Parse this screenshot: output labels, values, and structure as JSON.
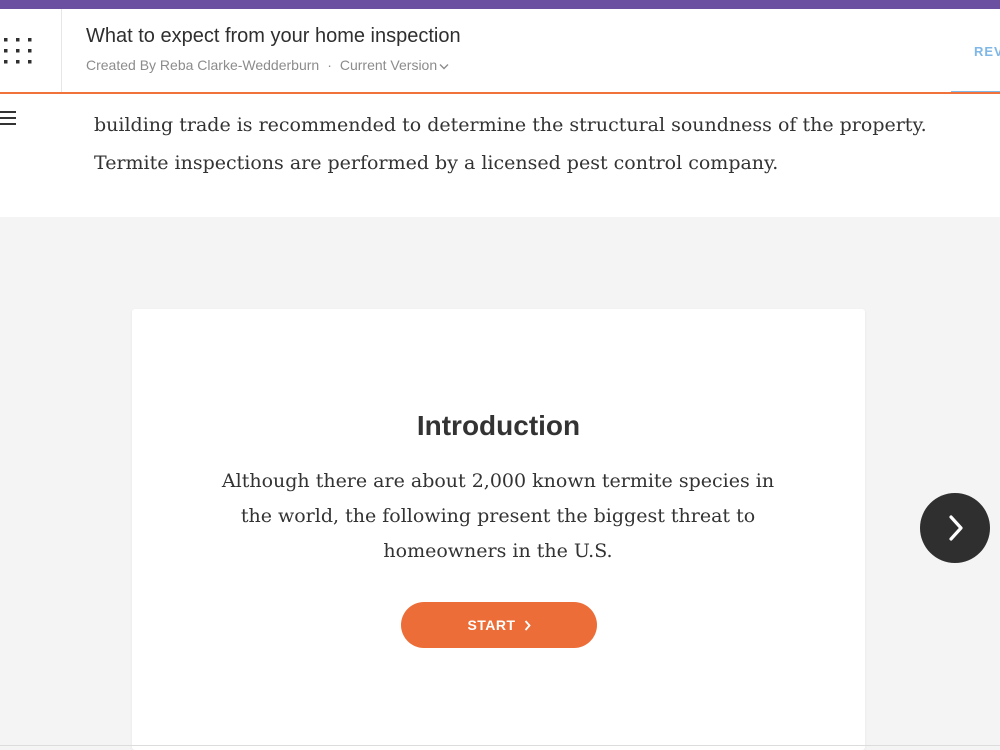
{
  "header": {
    "title": "What to expect from your home inspection",
    "created_by": "Created By Reba Clarke-Wedderburn",
    "separator": "·",
    "version_label": "Current Version",
    "review_tab": "REV",
    "icons": {
      "apps": "grid-dots-icon",
      "version_dropdown": "chevron-down-icon"
    }
  },
  "content": {
    "paragraph": "building trade is recommended to determine the structural soundness of the property. Termite inspections are performed by a licensed pest control company."
  },
  "intro_card": {
    "heading": "Introduction",
    "text": "Although there are about 2,000 known termite species in the world, the following present the biggest threat to homeowners in the U.S.",
    "start_label": "START",
    "icons": {
      "start": "chevron-right-icon"
    }
  },
  "navigation": {
    "next_icon": "chevron-right-icon",
    "menu_icon": "hamburger-menu-icon"
  },
  "colors": {
    "top_strip": "#6b4fa0",
    "accent": "#ec6d38",
    "review": "#7fb7e6",
    "text": "#333333",
    "background_gray": "#f4f4f4",
    "next_button": "#2f2f2f"
  }
}
